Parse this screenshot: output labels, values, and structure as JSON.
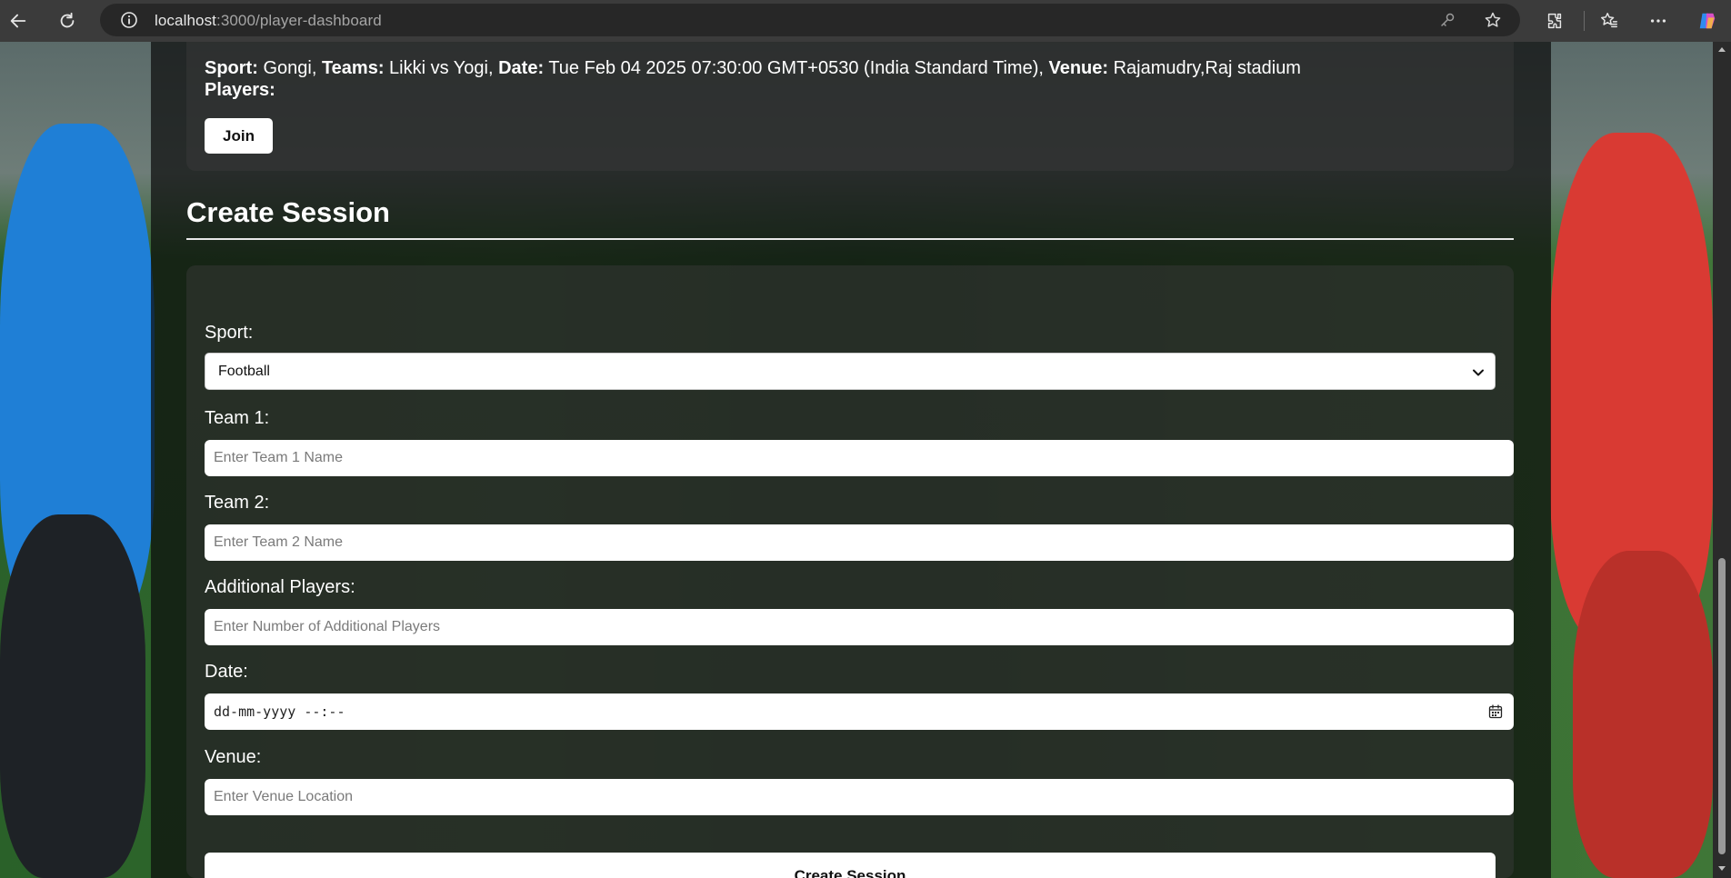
{
  "browser": {
    "url_host": "localhost",
    "url_rest": ":3000/player-dashboard"
  },
  "session": {
    "sport_label": "Sport:",
    "sport_value": " Gongi, ",
    "teams_label": "Teams:",
    "teams_value": " Likki vs Yogi, ",
    "date_label": "Date:",
    "date_value": " Tue Feb 04 2025 07:30:00 GMT+0530 (India Standard Time), ",
    "venue_label": "Venue:",
    "venue_value": " Rajamudry,Raj stadium",
    "players_label": "Players:",
    "join_label": "Join"
  },
  "create_session": {
    "title": "Create Session",
    "sport_label": "Sport:",
    "sport_selected": "Football",
    "team1_label": "Team 1:",
    "team1_placeholder": "Enter Team 1 Name",
    "team2_label": "Team 2:",
    "team2_placeholder": "Enter Team 2 Name",
    "additional_label": "Additional Players:",
    "additional_placeholder": "Enter Number of Additional Players",
    "date_label": "Date:",
    "date_placeholder": "dd-mm-yyyy --:--",
    "venue_label": "Venue:",
    "venue_placeholder": "Enter Venue Location",
    "submit_label": "Create Session"
  },
  "icons": {
    "back": "back-arrow-icon",
    "refresh": "refresh-icon",
    "info": "info-icon",
    "key": "key-icon",
    "favorite": "star-icon",
    "extensions": "puzzle-icon",
    "favorites_list": "favorites-icon",
    "more": "more-icon",
    "copilot": "copilot-icon",
    "calendar": "calendar-icon",
    "chevron": "chevron-down-icon"
  },
  "colors": {
    "chrome_bg": "#3b3b3b",
    "address_bg": "#272727",
    "panel_overlay": "rgba(12,12,12,0.72)",
    "button_bg": "#ffffff"
  }
}
